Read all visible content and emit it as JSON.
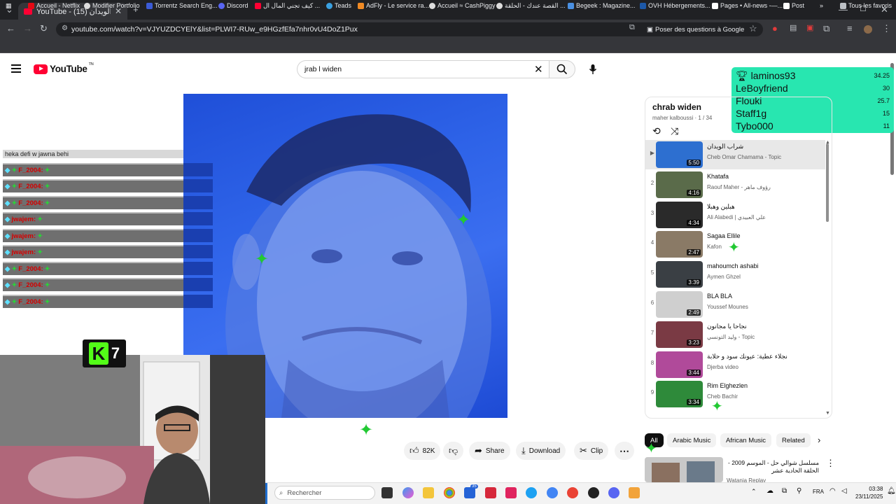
{
  "browser": {
    "tab_title": "YouTube - شراب الويدان (15)",
    "url": "youtube.com/watch?v=VJYUZDCYElY&list=PLWI7-RUw_e9HGzfEfa7nhr0vU4DoZ1Pux",
    "ask_google": "Poser des questions à Google",
    "bookmarks": [
      "Accueil - Netflix",
      "Modifier Portfolio",
      "Torrentz Search Eng...",
      "Discord",
      "كيف تجني المال ال ...",
      "Teads",
      "AdFly - Le service ra...",
      "Accueil ≈ CashPiggy",
      "القصة عندك - الحلقة ...",
      "Begeek : Magazine...",
      "OVH Hébergements...",
      "Pages • All-news -—...",
      "Post",
      "Tous les favoris"
    ]
  },
  "youtube": {
    "logo_text": "YouTube",
    "logo_sup": "TN",
    "search_value": "jrab l widen"
  },
  "leaderboard": [
    {
      "name": "laminos93",
      "score": "34.25"
    },
    {
      "name": "LeBoyfriend",
      "score": "30"
    },
    {
      "name": "Flouki",
      "score": "25.7"
    },
    {
      "name": "Staff1g",
      "score": "15"
    },
    {
      "name": "Tybo000",
      "score": "11"
    }
  ],
  "chat": {
    "header": "heka defi w jawna behi",
    "rows": [
      {
        "user": "F_2004:",
        "color": "#d40000"
      },
      {
        "user": "F_2004:",
        "color": "#d40000"
      },
      {
        "user": "F_2004:",
        "color": "#d40000"
      },
      {
        "user": "jwajem:",
        "color": "#d40000"
      },
      {
        "user": "jwajem:",
        "color": "#d40000"
      },
      {
        "user": "jwajem:",
        "color": "#d40000"
      },
      {
        "user": "F_2004:",
        "color": "#d40000"
      },
      {
        "user": "F_2004:",
        "color": "#d40000"
      },
      {
        "user": "F_2004:",
        "color": "#d40000"
      }
    ]
  },
  "kick_badge": {
    "number": "7"
  },
  "actions": {
    "likes": "82K",
    "share": "Share",
    "download": "Download",
    "clip": "Clip"
  },
  "playlist": {
    "title": "chrab widen",
    "subtitle": "maher kalboussi · 1 / 34",
    "items": [
      {
        "idx": "▶",
        "title": "شراب الويدان",
        "artist": "Cheb Omar Chamama - Topic",
        "duration": "5:50",
        "thumb": "#2d6fd0"
      },
      {
        "idx": "2",
        "title": "Khatafa",
        "artist": "Raouf Maher - رؤوف ماهر",
        "duration": "4:16",
        "thumb": "#5a6b4a"
      },
      {
        "idx": "3",
        "title": "هبلين وهبلا",
        "artist": "Ali Alabedi | علي العبيدي",
        "duration": "4:34",
        "thumb": "#2a2a2a"
      },
      {
        "idx": "4",
        "title": "Sagaa Ellile",
        "artist": "Kafon",
        "duration": "2:47",
        "thumb": "#8a7a66"
      },
      {
        "idx": "5",
        "title": "mahoumch ashabi",
        "artist": "Aymen Ghzel",
        "duration": "3:39",
        "thumb": "#3a3f44"
      },
      {
        "idx": "6",
        "title": "BLA BLA",
        "artist": "Youssef Mounes",
        "duration": "2:49",
        "thumb": "#cfcfcf"
      },
      {
        "idx": "7",
        "title": "نجاحا يا مجانون",
        "artist": "وليد التونسي - Topic",
        "duration": "3:23",
        "thumb": "#7a3a44"
      },
      {
        "idx": "8",
        "title": "نجلاء عطية: عيونك سود و حلابة",
        "artist": "Djerba video",
        "duration": "3:44",
        "thumb": "#b04a9a"
      },
      {
        "idx": "9",
        "title": "Rim Elghezlen",
        "artist": "Cheb Bachir",
        "duration": "3:34",
        "thumb": "#2e8a3a"
      }
    ]
  },
  "chips": [
    "All",
    "Arabic Music",
    "African Music",
    "Related"
  ],
  "recommended": {
    "title": "مسلسل شوالي حل - الموسم 2009 - الحلقة الحادية عشر",
    "channel": "Watania Replay"
  },
  "taskbar": {
    "search_placeholder": "Rechercher",
    "lang": "FRA",
    "time": "03:38",
    "date": "23/11/2025"
  }
}
